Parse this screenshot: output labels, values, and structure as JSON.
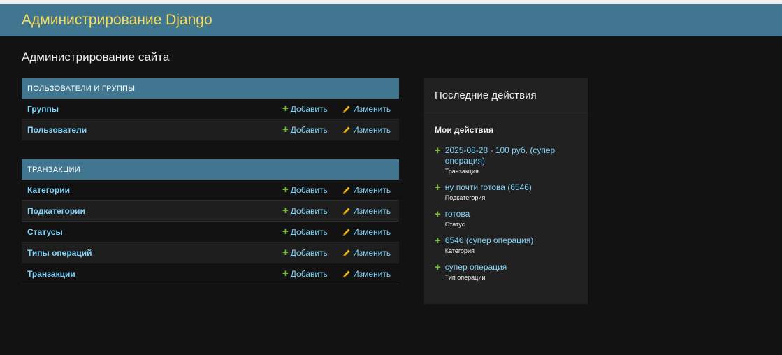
{
  "header": {
    "site_name": "Администрирование Django"
  },
  "page": {
    "title": "Администрирование сайта"
  },
  "modules": [
    {
      "caption": "Пользователи и группы",
      "rows": [
        {
          "name": "Группы",
          "add": "Добавить",
          "change": "Изменить"
        },
        {
          "name": "Пользователи",
          "add": "Добавить",
          "change": "Изменить"
        }
      ]
    },
    {
      "caption": "Транзакции",
      "rows": [
        {
          "name": "Категории",
          "add": "Добавить",
          "change": "Изменить"
        },
        {
          "name": "Подкатегории",
          "add": "Добавить",
          "change": "Изменить"
        },
        {
          "name": "Статусы",
          "add": "Добавить",
          "change": "Изменить"
        },
        {
          "name": "Типы операций",
          "add": "Добавить",
          "change": "Изменить"
        },
        {
          "name": "Транзакции",
          "add": "Добавить",
          "change": "Изменить"
        }
      ]
    }
  ],
  "recent": {
    "title": "Последние действия",
    "subtitle": "Мои действия",
    "actions": [
      {
        "label": "2025-08-28 - 100 руб. (супер операция)",
        "type": "Транзакция"
      },
      {
        "label": "ну почти готова (6546)",
        "type": "Подкатегория"
      },
      {
        "label": "готова",
        "type": "Статус"
      },
      {
        "label": "6546 (супер операция)",
        "type": "Категория"
      },
      {
        "label": "супер операция",
        "type": "Тип операции"
      }
    ]
  },
  "colors": {
    "header_bg": "#417690",
    "site_name": "#f5dd5d",
    "link": "#81d4fa",
    "add_icon": "#70bf2b",
    "change_icon": "#efb80b"
  },
  "icons": {
    "add": "plus-icon",
    "change": "pencil-icon"
  }
}
